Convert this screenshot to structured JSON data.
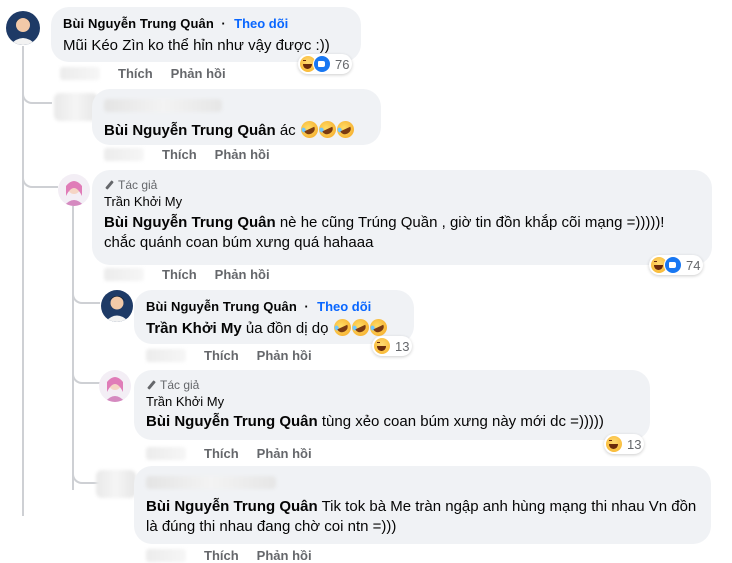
{
  "labels": {
    "like": "Thích",
    "reply": "Phản hồi",
    "follow": "Theo dõi",
    "dot": "·",
    "author": "Tác giả"
  },
  "comments": [
    {
      "name": "Bùi Nguyễn Trung Quân",
      "text": "Mũi Kéo Zìn ko thể hỉn như vậy được :))",
      "reactions": [
        "haha-icon",
        "like-icon"
      ],
      "count": "76"
    },
    {
      "mention": "Bùi Nguyễn Trung Quân",
      "text": "ác"
    },
    {
      "name": "Trần Khởi My",
      "mention": "Bùi Nguyễn Trung Quân",
      "text": "nè he cũng Trúng Quần , giờ tin đồn khắp cõi mạng =)))))! chắc quánh coan búm xưng quá hahaaa",
      "reactions": [
        "haha-icon",
        "like-icon"
      ],
      "count": "74"
    },
    {
      "name": "Bùi Nguyễn Trung Quân",
      "mention": "Trần Khởi My",
      "text": "ủa đồn dị dọ",
      "reactions": [
        "haha-icon"
      ],
      "count": "13"
    },
    {
      "name": "Trần Khởi My",
      "mention": "Bùi Nguyễn Trung Quân",
      "text": "tùng xẻo coan búm xưng này mới dc =)))))",
      "reactions": [
        "haha-icon"
      ],
      "count": "13"
    },
    {
      "mention": "Bùi Nguyễn Trung Quân",
      "text": "Tik tok bà Me tràn ngập anh hùng mạng thi nhau Vn đồn là đúng thi nhau đang chờ coi ntn =)))"
    }
  ],
  "colors": {
    "bubble": "#f0f2f5",
    "link": "#0866ff",
    "secondary": "#65676b",
    "thread": "#ced0d4"
  }
}
